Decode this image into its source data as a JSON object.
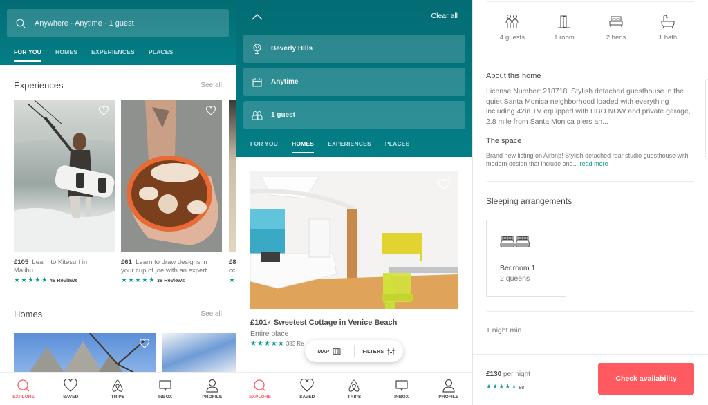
{
  "colors": {
    "teal": "#047e86",
    "accent": "#ff5a5f",
    "star": "#0d9a93"
  },
  "panel1": {
    "search_placeholder": "Anywhere · Anytime · 1 guest",
    "tabs": [
      {
        "label": "FOR YOU",
        "active": true
      },
      {
        "label": "HOMES",
        "active": false
      },
      {
        "label": "EXPERIENCES",
        "active": false
      },
      {
        "label": "PLACES",
        "active": false
      }
    ],
    "experiences": {
      "title": "Experiences",
      "see_all": "See all",
      "cards": [
        {
          "price": "£105",
          "title_line1": "Learn to Kitesurf in",
          "title_line2": "Malibu",
          "rating": 5,
          "reviews": "46 Reviews",
          "image": "kitesurfer-photo"
        },
        {
          "price": "£61",
          "title_line1": "Learn to draw designs in",
          "title_line2": "your cup of joe with an expert...",
          "rating": 5,
          "reviews": "38 Reviews",
          "image": "latte-art-photo"
        },
        {
          "price": "£8",
          "title_line1": "",
          "title_line2": "cc",
          "rating": 5,
          "reviews": "",
          "image": "partial-photo"
        }
      ]
    },
    "homes": {
      "title": "Homes",
      "see_all": "See all"
    }
  },
  "panel2": {
    "clear_all": "Clear all",
    "fields": [
      {
        "icon": "globe-icon",
        "value": "Beverly Hills"
      },
      {
        "icon": "calendar-icon",
        "value": "Anytime"
      },
      {
        "icon": "guests-icon",
        "value": "1 guest"
      }
    ],
    "tabs": [
      {
        "label": "FOR YOU",
        "active": false
      },
      {
        "label": "HOMES",
        "active": true
      },
      {
        "label": "EXPERIENCES",
        "active": false
      },
      {
        "label": "PLACES",
        "active": false
      }
    ],
    "listing": {
      "price": "£101",
      "title": "Sweetest Cottage in Venice Beach",
      "type": "Entire place",
      "rating": 5,
      "reviews": "383 Re"
    },
    "map_label": "MAP",
    "filters_label": "FILTERS"
  },
  "nav": [
    {
      "label": "EXPLORE",
      "icon": "search-icon",
      "active": true
    },
    {
      "label": "SAVED",
      "icon": "heart-icon",
      "active": false
    },
    {
      "label": "TRIPS",
      "icon": "airbnb-logo-icon",
      "active": false
    },
    {
      "label": "INBOX",
      "icon": "message-icon",
      "active": false
    },
    {
      "label": "PROFILE",
      "icon": "profile-icon",
      "active": false
    }
  ],
  "panel3": {
    "amenities": [
      {
        "icon": "guests-icon",
        "label": "4 guests"
      },
      {
        "icon": "door-icon",
        "label": "1 room"
      },
      {
        "icon": "bed-icon",
        "label": "2 beds"
      },
      {
        "icon": "bath-icon",
        "label": "1 bath"
      }
    ],
    "about_title": "About this home",
    "about_text": "License Number: 218718. Stylish detached guesthouse in the quiet Santa Monica neighborhood loaded with everything including 42in TV equipped with HBO NOW and private garage, 2.8 mile from Santa Monica piers an...",
    "space_title": "The space",
    "space_text": "Brand new listing on Airbnb! Stylish detached rear studio guesthouse with modern design that include one...",
    "read_more": "read more",
    "sleeping_title": "Sleeping arrangements",
    "bedroom": {
      "name": "Bedroom 1",
      "beds": "2 queens"
    },
    "min_nights": "1 night min",
    "price": "£130",
    "per_night": "per night",
    "rating": 4.5,
    "reviews": "88",
    "cta": "Check availability"
  }
}
